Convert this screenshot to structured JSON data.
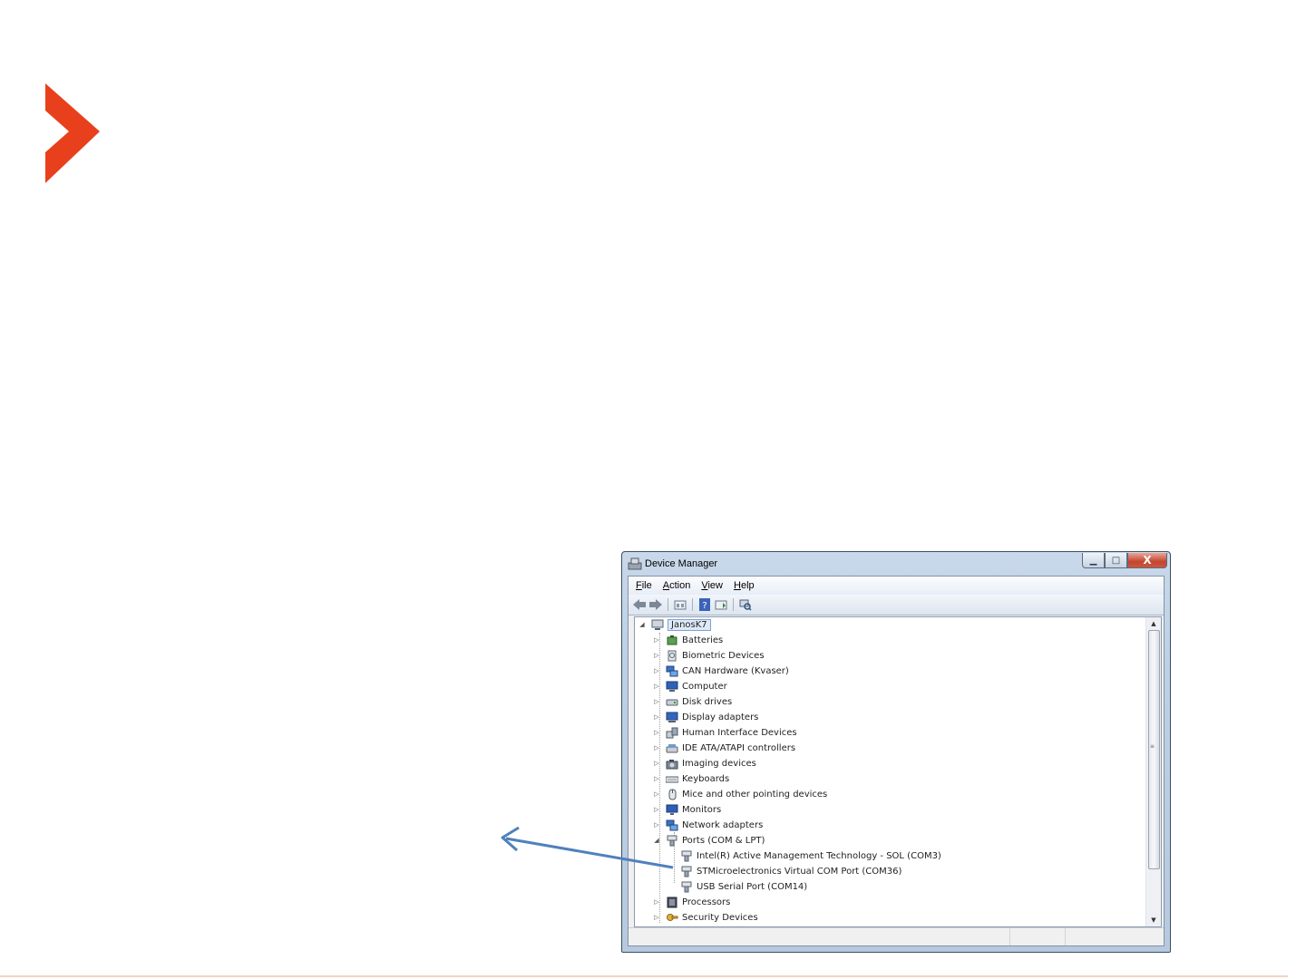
{
  "colors": {
    "logo": "#e8401c",
    "arrow": "#4f81bd",
    "bottom_line": "#f3d3c4"
  },
  "window": {
    "title": "Device Manager",
    "icon": "device-manager-icon",
    "caption": {
      "minimize": "▁",
      "maximize": "□",
      "close": "X"
    }
  },
  "menu": [
    "File",
    "Action",
    "View",
    "Help"
  ],
  "toolbar": [
    "back-icon",
    "forward-icon",
    "properties-icon",
    "help-icon",
    "update-driver-icon",
    "scan-hardware-icon"
  ],
  "tree": {
    "root": "JanosK7",
    "categories": [
      {
        "label": "Batteries",
        "icon": "batteries-icon",
        "expanded": false
      },
      {
        "label": "Biometric Devices",
        "icon": "biometric-icon",
        "expanded": false
      },
      {
        "label": "CAN Hardware (Kvaser)",
        "icon": "network-icon",
        "expanded": false
      },
      {
        "label": "Computer",
        "icon": "computer-icon",
        "expanded": false
      },
      {
        "label": "Disk drives",
        "icon": "disk-icon",
        "expanded": false
      },
      {
        "label": "Display adapters",
        "icon": "display-icon",
        "expanded": false
      },
      {
        "label": "Human Interface Devices",
        "icon": "hid-icon",
        "expanded": false
      },
      {
        "label": "IDE ATA/ATAPI controllers",
        "icon": "ide-icon",
        "expanded": false
      },
      {
        "label": "Imaging devices",
        "icon": "camera-icon",
        "expanded": false
      },
      {
        "label": "Keyboards",
        "icon": "keyboard-icon",
        "expanded": false
      },
      {
        "label": "Mice and other pointing devices",
        "icon": "mouse-icon",
        "expanded": false
      },
      {
        "label": "Monitors",
        "icon": "monitor-icon",
        "expanded": false
      },
      {
        "label": "Network adapters",
        "icon": "network-icon",
        "expanded": false
      },
      {
        "label": "Ports (COM & LPT)",
        "icon": "port-icon",
        "expanded": true,
        "children": [
          "Intel(R) Active Management Technology - SOL (COM3)",
          "STMicroelectronics Virtual COM Port (COM36)",
          "USB Serial Port (COM14)"
        ]
      },
      {
        "label": "Processors",
        "icon": "processor-icon",
        "expanded": false
      },
      {
        "label": "Security Devices",
        "icon": "security-icon",
        "expanded": false
      }
    ]
  }
}
